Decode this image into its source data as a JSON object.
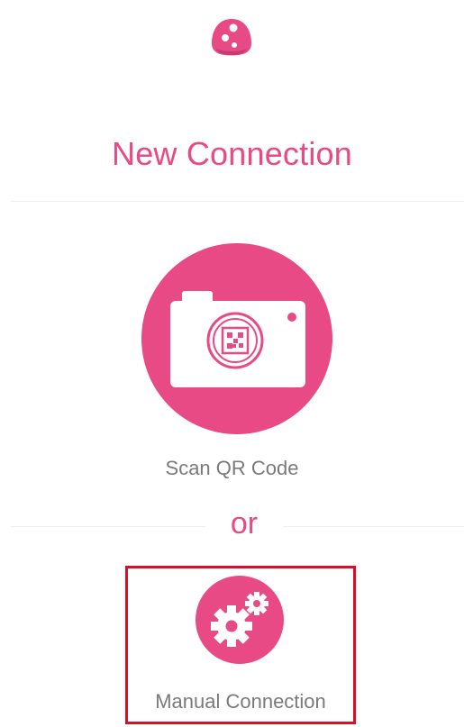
{
  "header": {
    "logo_icon": "app-logo-icon",
    "title": "New Connection"
  },
  "scan": {
    "icon": "camera-qr-icon",
    "label": "Scan QR Code"
  },
  "separator": {
    "text": "or"
  },
  "manual": {
    "icon": "gears-icon",
    "label": "Manual Connection"
  },
  "colors": {
    "accent": "#e84a85",
    "label_gray": "#7a7a7a",
    "highlight_border": "#d4102a",
    "divider": "#eeeeee"
  }
}
